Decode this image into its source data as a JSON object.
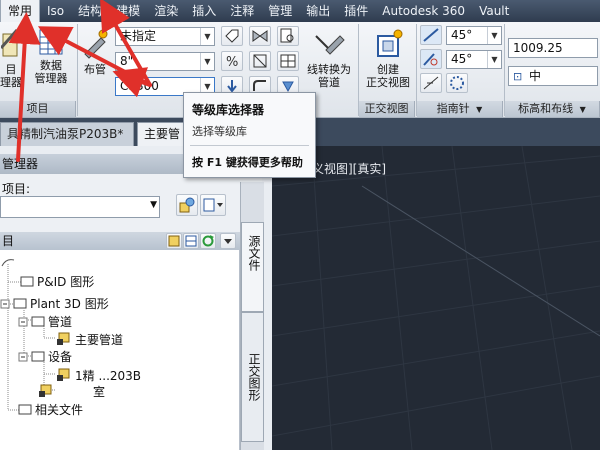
{
  "menu": {
    "tabs": [
      "常用",
      "Iso",
      "结构",
      "建模",
      "渲染",
      "插入",
      "注释",
      "管理",
      "输出",
      "插件",
      "Autodesk 360",
      "Vault"
    ],
    "active_index": 0
  },
  "ribbon": {
    "project_btn": "目\n理器",
    "data_manager_btn": "数据\n管理器",
    "pipe_btn": "布管",
    "combo_top": "未指定",
    "combo_mid": "8\"",
    "combo_spec": "CS300",
    "line_convert_btn": "线转换为\n管道",
    "ortho_btn": "创建\n正交视图",
    "ortho_group_label": "正交视图",
    "compass_group_label": "指南针",
    "elev_group_label": "标高和布线",
    "project_group_label": "项目",
    "angle1": "45°",
    "angle2": "45°",
    "elevation": "1009.25",
    "center": "中"
  },
  "tooltip": {
    "title": "等级库选择器",
    "desc": "选择等级库",
    "help": "按 F1 键获得更多帮助"
  },
  "doc_tabs": [
    {
      "label": "具精制汽油泵P203B*"
    },
    {
      "label": "主要管"
    }
  ],
  "panel": {
    "title": "管理器",
    "project_label": "项目:",
    "tree_header": "目",
    "side_tab1": "源文件",
    "side_tab2": "正交图形",
    "tree": [
      {
        "label": "P&ID 图形"
      },
      {
        "label": "Plant 3D 图形"
      },
      {
        "label": "管道"
      },
      {
        "label": "主要管道"
      },
      {
        "label": "设备"
      },
      {
        "label": "1精   ...203B"
      },
      {
        "label": "室"
      },
      {
        "label": "相关文件"
      }
    ]
  },
  "canvas": {
    "label": "义视图][真实]"
  }
}
